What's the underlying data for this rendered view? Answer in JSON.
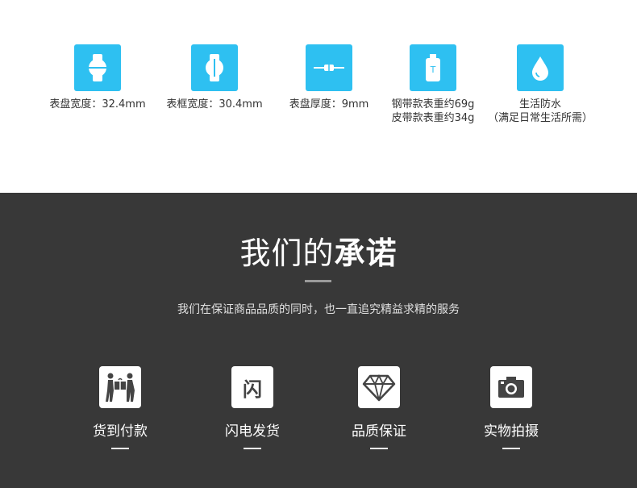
{
  "specs": [
    {
      "icon": "watch-face-width-icon",
      "lines": [
        "表盘宽度：32.4mm"
      ]
    },
    {
      "icon": "watch-frame-width-icon",
      "lines": [
        "表框宽度：30.4mm"
      ]
    },
    {
      "icon": "watch-thickness-icon",
      "lines": [
        "表盘厚度：9mm"
      ]
    },
    {
      "icon": "weight-icon",
      "lines": [
        "钢带款表重约69g",
        "皮带款表重约34g"
      ]
    },
    {
      "icon": "water-drop-icon",
      "lines": [
        "生活防水",
        "（满足日常生活所需）"
      ]
    }
  ],
  "promise": {
    "title_light": "我们的",
    "title_bold": "承诺",
    "subtitle": "我们在保证商品品质的同时，也一直追究精益求精的服务",
    "items": [
      {
        "icon": "handshake-delivery-icon",
        "label": "货到付款"
      },
      {
        "icon": "flash-icon",
        "label": "闪电发货",
        "glyph": "闪"
      },
      {
        "icon": "diamond-icon",
        "label": "品质保证"
      },
      {
        "icon": "camera-icon",
        "label": "实物拍摄"
      }
    ]
  },
  "colors": {
    "accent_blue": "#2ec0f1",
    "dark_bg": "#383838"
  }
}
